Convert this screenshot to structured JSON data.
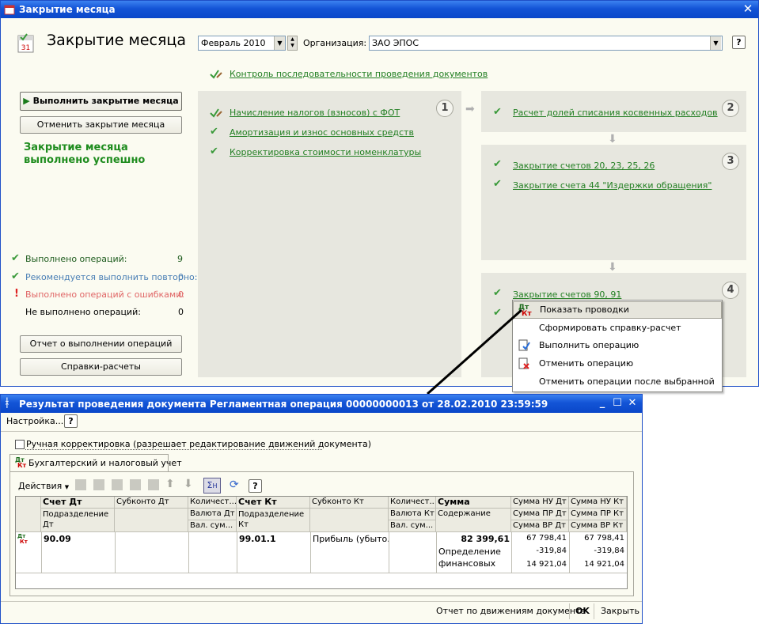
{
  "main_window": {
    "title": "Закрытие месяца",
    "header_title": "Закрытие месяца",
    "period": "Февраль 2010",
    "org_label": "Организация:",
    "org_value": "ЗАО ЭПОС",
    "help": "?",
    "calendar_day": "31",
    "link_control": "Контроль последовательности проведения документов",
    "run_button": "Выполнить закрытие месяца",
    "cancel_button": "Отменить закрытие месяца",
    "success_line1": "Закрытие месяца",
    "success_line2": "выполнено успешно",
    "stats": [
      {
        "label": "Выполнено операций:",
        "value": "9",
        "icon": "check-icon",
        "color": "#1e5c1e"
      },
      {
        "label": "Рекомендуется выполнить повторно:",
        "value": "0",
        "icon": "check-icon",
        "color": "#4a7fb5"
      },
      {
        "label": "Выполнено операций с ошибками:",
        "value": "0",
        "icon": "exclamation-icon",
        "color": "#e06666"
      },
      {
        "label": "Не выполнено операций:",
        "value": "0",
        "icon": "",
        "color": "#000000"
      }
    ],
    "report_button": "Отчет о выполнении операций",
    "calc_button": "Справки-расчеты",
    "group1": {
      "number": "1",
      "items": [
        "Начисление налогов (взносов) с ФОТ",
        "Амортизация и износ основных средств",
        "Корректировка стоимости номенклатуры"
      ]
    },
    "group2": {
      "number": "2",
      "items": [
        "Расчет долей списания косвенных расходов"
      ]
    },
    "group3": {
      "number": "3",
      "items": [
        "Закрытие счетов 20, 23, 25, 26",
        "Закрытие счета 44 \"Издержки обращения\""
      ]
    },
    "group4": {
      "number": "4",
      "items": [
        "Закрытие счетов 90, 91"
      ]
    }
  },
  "context_menu": {
    "items": [
      {
        "label": "Показать проводки",
        "icon": "dt-kt-icon"
      },
      {
        "label": "Сформировать справку-расчет",
        "icon": ""
      },
      {
        "label": "Выполнить операцию",
        "icon": "run-doc-icon"
      },
      {
        "label": "Отменить операцию",
        "icon": "cancel-doc-icon"
      },
      {
        "label": "Отменить операции после выбранной",
        "icon": ""
      }
    ]
  },
  "doc_window": {
    "title": "Результат проведения документа Регламентная операция 00000000013 от 28.02.2010 23:59:59",
    "settings_menu": "Настройка...",
    "help": "?",
    "manual_checkbox": "Ручная корректировка (разрешает редактирование движений документа)",
    "tab": "Бухгалтерский и налоговый учет",
    "actions_menu": "Действия",
    "columns": {
      "r1": [
        "Счет Дт",
        "Субконто Дт",
        "Количест...",
        "Счет Кт",
        "Субконто Кт",
        "Количест...",
        "Сумма",
        "Сумма НУ Дт",
        "Сумма НУ Кт"
      ],
      "r2": [
        "Подразделение",
        "Валюта Дт",
        "Подразделение",
        "Валюта Кт",
        "Содержание",
        "Сумма ПР Дт",
        "Сумма ПР Кт"
      ],
      "r3": [
        "Дт",
        "Вал. сум...",
        "Кт",
        "Вал. сум...",
        "Сумма ВР Дт",
        "Сумма ВР Кт"
      ]
    },
    "row": {
      "account_dt": "90.09",
      "account_kt": "99.01.1",
      "subconto_kt": "Прибыль (убыто...",
      "amount": "82 399,61",
      "content1": "Определение",
      "content2": "финансовых",
      "nu_dt": "67 798,41",
      "nu_kt": "67 798,41",
      "pr_dt": "-319,84",
      "pr_kt": "-319,84",
      "vr_dt": "14 921,04",
      "vr_kt": "14 921,04"
    },
    "footer_report": "Отчет по движениям документа",
    "ok": "OK",
    "close": "Закрыть"
  }
}
